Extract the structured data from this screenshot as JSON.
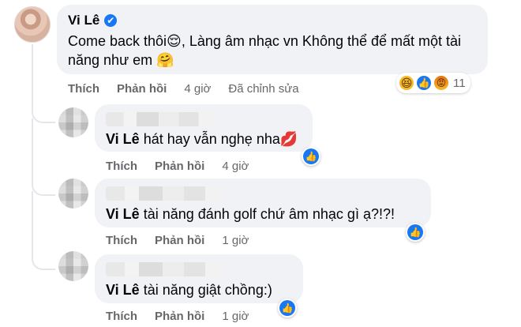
{
  "main_comment": {
    "author": "Vi Lê",
    "verified_icon": "✔",
    "text": "Come back thôi😌, Làng âm nhạc vn Không thể để mất một tài năng như em 🤗",
    "actions": {
      "like": "Thích",
      "reply": "Phản hồi",
      "time": "4 giờ",
      "edited": "Đã chỉnh sửa"
    },
    "reactions": {
      "icons": [
        "😆",
        "👍",
        "😡"
      ],
      "count": "11"
    }
  },
  "replies": [
    {
      "mention": "Vi Lê",
      "text": " hát hay vẫn nghẹ nha💋",
      "actions": {
        "like": "Thích",
        "reply": "Phản hồi",
        "time": "4 giờ"
      },
      "reaction_icon": "👍"
    },
    {
      "mention": "Vi Lê",
      "text": " tài năng đánh golf chứ âm nhạc gì ạ?!?!",
      "actions": {
        "like": "Thích",
        "reply": "Phản hồi",
        "time": "1 giờ"
      },
      "reaction_icon": "👍"
    },
    {
      "mention": "Vi Lê",
      "text": " tài năng giật chồng:)",
      "actions": {
        "like": "Thích",
        "reply": "Phản hồi",
        "time": "1 giờ"
      },
      "reaction_icon": "👍"
    }
  ]
}
